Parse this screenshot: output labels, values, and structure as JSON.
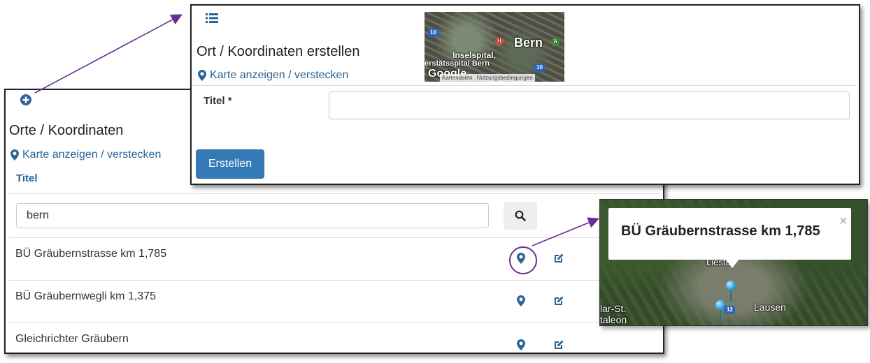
{
  "list_panel": {
    "add_icon": "plus-circle-icon",
    "title": "Orte / Koordinaten",
    "map_toggle_label": "Karte anzeigen / verstecken",
    "column_header": "Titel",
    "search": {
      "value": "bern",
      "placeholder": ""
    },
    "rows": [
      {
        "label": "BÜ Gräubernstrasse km 1,785"
      },
      {
        "label": "BÜ Gräubernwegli km 1,375"
      },
      {
        "label": "Gleichrichter Gräubern"
      }
    ]
  },
  "create_panel": {
    "list_icon": "list-icon",
    "title": "Ort / Koordinaten erstellen",
    "map_toggle_label": "Karte anzeigen / verstecken",
    "map": {
      "city_label": "Bern",
      "hospital_label_1": "Inselspital,",
      "hospital_label_2": "erstätsspital Bern",
      "google_label": "Google",
      "road_1": "10",
      "road_2": "10",
      "footer_data": "Kartendaten",
      "footer_terms": "Nutzungsbedingungen"
    },
    "field_label": "Titel *",
    "field_value": "",
    "submit_label": "Erstellen"
  },
  "popup": {
    "title": "BÜ Gräubernstrasse km 1,785",
    "close_symbol": "×",
    "places": {
      "left": "lar-St.",
      "left2": "taleon",
      "right": "Lausen",
      "top": "Liestal"
    },
    "road_badge": "12"
  },
  "colors": {
    "link_blue": "#2a6496",
    "button_blue": "#337ab7",
    "annotation_purple": "#6a2c91"
  }
}
